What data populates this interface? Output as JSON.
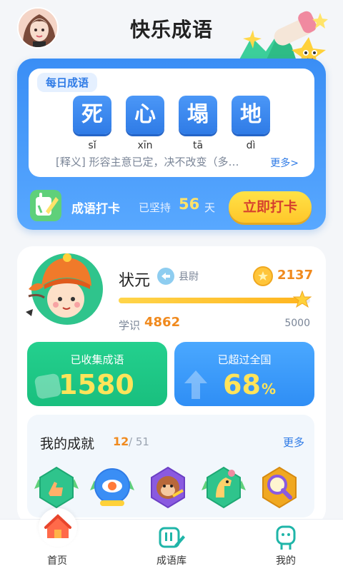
{
  "header": {
    "title": "快乐成语"
  },
  "daily": {
    "tag": "每日成语",
    "chars": [
      "死",
      "心",
      "塌",
      "地"
    ],
    "pinyin": [
      "sǐ",
      "xīn",
      "tā",
      "dì"
    ],
    "meaning": "[释义] 形容主意已定，决不改变（多…",
    "more": "更多>"
  },
  "checkin": {
    "label": "成语打卡",
    "persist": "已坚持",
    "days": "56",
    "unit": "天",
    "button": "立即打卡"
  },
  "profile": {
    "rank": "状元",
    "rank_sub": "县尉",
    "coins": "2137",
    "xp_label": "学识",
    "xp": "4862",
    "xp_max": "5000",
    "xp_progress": 0.972
  },
  "stats": {
    "collected_title": "已收集成语",
    "collected": "1580",
    "surpass_title": "已超过全国",
    "surpass": "68",
    "surpass_unit": "%"
  },
  "achievements": {
    "title": "我的成就",
    "count": "12",
    "total": "/ 51",
    "more": "更多"
  },
  "tabs": [
    {
      "label": "首页"
    },
    {
      "label": "成语库"
    },
    {
      "label": "我的"
    }
  ],
  "colors": {
    "accent": "#2f7be6",
    "green": "#19bf7e",
    "orange": "#f08a1e",
    "yellow": "#ffc72a"
  }
}
